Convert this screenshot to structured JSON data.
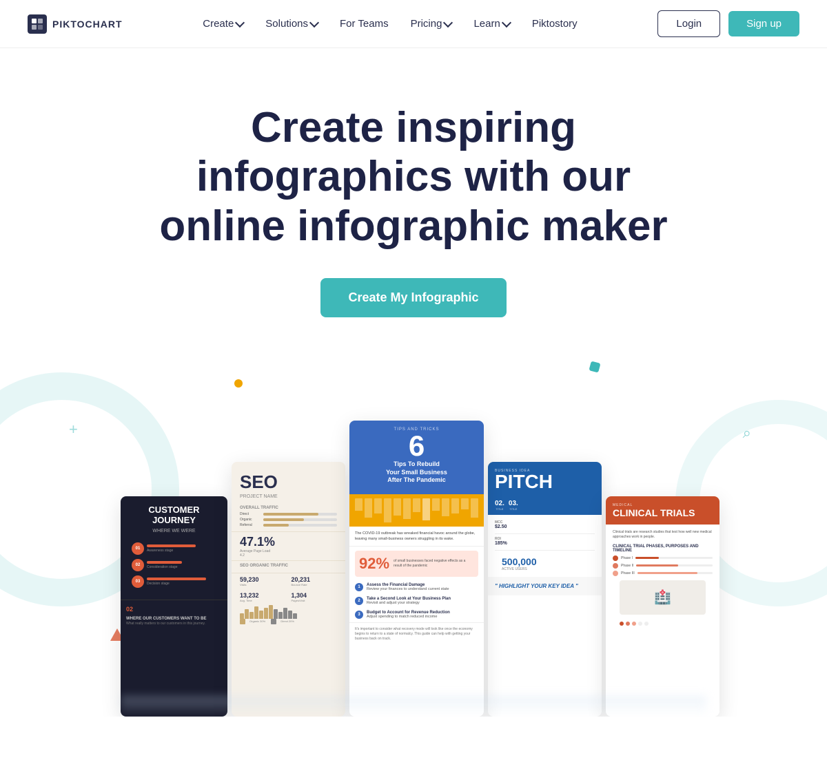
{
  "brand": {
    "name": "PIKTOCHART"
  },
  "nav": {
    "links": [
      {
        "label": "Create",
        "hasDropdown": true
      },
      {
        "label": "Solutions",
        "hasDropdown": true
      },
      {
        "label": "For Teams",
        "hasDropdown": false
      },
      {
        "label": "Pricing",
        "hasDropdown": true
      },
      {
        "label": "Learn",
        "hasDropdown": true
      },
      {
        "label": "Piktostory",
        "hasDropdown": false
      }
    ],
    "login_label": "Login",
    "signup_label": "Sign up"
  },
  "hero": {
    "title": "Create inspiring infographics with our online infographic maker",
    "cta_label": "Create My Infographic"
  },
  "cards": {
    "customer": {
      "title": "CUSTOMER journey",
      "subtitle": "WHERE WE WERE"
    },
    "seo": {
      "title": "SEO",
      "overall_traffic": "OVERALL TRAFFIC",
      "big_num": "47.1%",
      "traffic_1": "59,230",
      "traffic_2": "20,231",
      "traffic_3": "13,232",
      "traffic_4": "1,304"
    },
    "tips": {
      "num": "6",
      "title_line1": "Tips To Rebuild",
      "title_line2": "Your Small Business",
      "title_line3": "After The Pandemic",
      "percent": "92%",
      "intro": "The COVID-19 outbreak has wreaked financial havoc around the globe, leaving many small-business owners struggling in its wake.",
      "footer": "It's important to consider what recovery mode will look like once the economy begins to return to a state of normalcy. This guide can help with getting your business back on track."
    },
    "pitch": {
      "top_label": "BUSINESS IDEA",
      "title": "PITCH",
      "metric1_num": "02.",
      "metric1_label": "TITLE",
      "metric2_num": "03.",
      "metric2_label": "TITLE",
      "big_num": "500,000",
      "big_label": "ACTIVE USERS",
      "quote": "\" HIGHLIGHT YOUR KEY IDEA \""
    },
    "clinical": {
      "label": "CLINICAL TRIALS",
      "title": "CLINICAL TRIALS",
      "section_title": "CLINICAL TRIAL PHASES, PURPOSES AND TIMELINE"
    }
  }
}
